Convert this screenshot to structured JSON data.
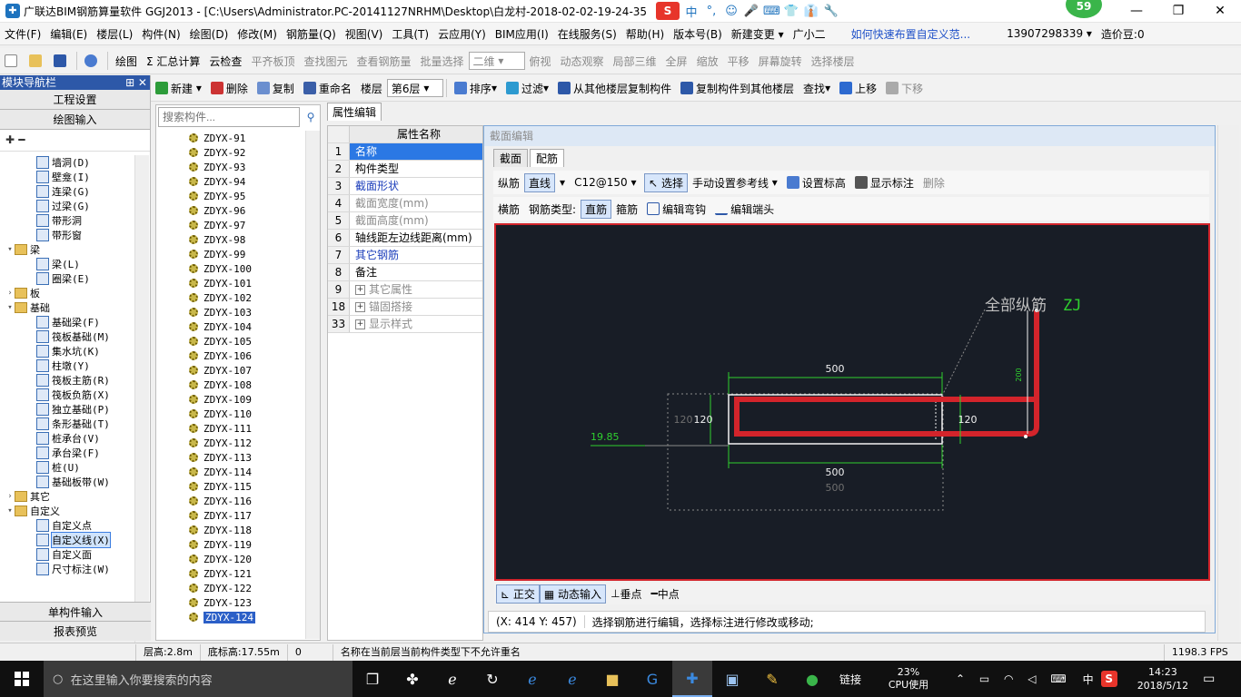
{
  "title_bar": {
    "title": "广联达BIM钢筋算量软件 GGJ2013 - [C:\\Users\\Administrator.PC-20141127NRHM\\Desktop\\白龙村-2018-02-02-19-24-35",
    "ime": [
      "中",
      "°,",
      "☺",
      "🎤",
      "⌨",
      "👕",
      "👔",
      "🔧"
    ],
    "badge": "59",
    "controls": [
      "—",
      "❐",
      "✕"
    ]
  },
  "menu": [
    "文件(F)",
    "编辑(E)",
    "楼层(L)",
    "构件(N)",
    "绘图(D)",
    "修改(M)",
    "钢筋量(Q)",
    "视图(V)",
    "工具(T)",
    "云应用(Y)",
    "BIM应用(I)",
    "在线服务(S)",
    "帮助(H)",
    "版本号(B)",
    "新建变更 ▾",
    "广小二"
  ],
  "menu_link": "如何快速布置自定义范...",
  "account": "13907298339 ▾",
  "beans": "造价豆:0",
  "toolbar1": [
    "绘图",
    "Σ 汇总计算",
    "云检查",
    "平齐板顶",
    "查找图元",
    "查看钢筋量",
    "批量选择",
    "二维",
    "俯视",
    "动态观察",
    "局部三维",
    "全屏",
    "缩放",
    "平移",
    "屏幕旋转",
    "选择楼层"
  ],
  "toolbar2": [
    "新建",
    "删除",
    "复制",
    "重命名",
    "楼层",
    "第6层",
    "排序",
    "过滤",
    "从其他楼层复制构件",
    "复制构件到其他楼层",
    "查找",
    "上移",
    "下移"
  ],
  "nav": {
    "header": "模块导航栏",
    "pin": "⊞ ✕",
    "project_settings": "工程设置",
    "drawing_input": "绘图输入",
    "single_input": "单构件输入",
    "report_preview": "报表预览",
    "tree": [
      {
        "label": "墙洞(D)",
        "level": 2
      },
      {
        "label": "壁龛(I)",
        "level": 2
      },
      {
        "label": "连梁(G)",
        "level": 2
      },
      {
        "label": "过梁(G)",
        "level": 2
      },
      {
        "label": "带形洞",
        "level": 2
      },
      {
        "label": "带形窗",
        "level": 2
      },
      {
        "label": "梁",
        "level": 1,
        "folder": true,
        "exp": "▾"
      },
      {
        "label": "梁(L)",
        "level": 2
      },
      {
        "label": "圈梁(E)",
        "level": 2
      },
      {
        "label": "板",
        "level": 1,
        "folder": true,
        "exp": "›"
      },
      {
        "label": "基础",
        "level": 1,
        "folder": true,
        "exp": "▾"
      },
      {
        "label": "基础梁(F)",
        "level": 2
      },
      {
        "label": "筏板基础(M)",
        "level": 2
      },
      {
        "label": "集水坑(K)",
        "level": 2
      },
      {
        "label": "柱墩(Y)",
        "level": 2
      },
      {
        "label": "筏板主筋(R)",
        "level": 2
      },
      {
        "label": "筏板负筋(X)",
        "level": 2
      },
      {
        "label": "独立基础(P)",
        "level": 2
      },
      {
        "label": "条形基础(T)",
        "level": 2
      },
      {
        "label": "桩承台(V)",
        "level": 2
      },
      {
        "label": "承台梁(F)",
        "level": 2
      },
      {
        "label": "桩(U)",
        "level": 2
      },
      {
        "label": "基础板带(W)",
        "level": 2
      },
      {
        "label": "其它",
        "level": 1,
        "folder": true,
        "exp": "›"
      },
      {
        "label": "自定义",
        "level": 1,
        "folder": true,
        "exp": "▾"
      },
      {
        "label": "自定义点",
        "level": 2
      },
      {
        "label": "自定义线(X)",
        "level": 2,
        "selected": true
      },
      {
        "label": "自定义面",
        "level": 2
      },
      {
        "label": "尺寸标注(W)",
        "level": 2
      }
    ]
  },
  "components": {
    "search_placeholder": "搜索构件...",
    "items": [
      "ZDYX-91",
      "ZDYX-92",
      "ZDYX-93",
      "ZDYX-94",
      "ZDYX-95",
      "ZDYX-96",
      "ZDYX-97",
      "ZDYX-98",
      "ZDYX-99",
      "ZDYX-100",
      "ZDYX-101",
      "ZDYX-102",
      "ZDYX-103",
      "ZDYX-104",
      "ZDYX-105",
      "ZDYX-106",
      "ZDYX-107",
      "ZDYX-108",
      "ZDYX-109",
      "ZDYX-110",
      "ZDYX-111",
      "ZDYX-112",
      "ZDYX-113",
      "ZDYX-114",
      "ZDYX-115",
      "ZDYX-116",
      "ZDYX-117",
      "ZDYX-118",
      "ZDYX-119",
      "ZDYX-120",
      "ZDYX-121",
      "ZDYX-122",
      "ZDYX-123",
      "ZDYX-124"
    ],
    "selected": "ZDYX-124"
  },
  "properties": {
    "tab": "属性编辑",
    "header": "属性名称",
    "rows": [
      {
        "n": "1",
        "label": "名称",
        "style": "sel"
      },
      {
        "n": "2",
        "label": "构件类型",
        "style": ""
      },
      {
        "n": "3",
        "label": "截面形状",
        "style": "blue"
      },
      {
        "n": "4",
        "label": "截面宽度(mm)",
        "style": "gray"
      },
      {
        "n": "5",
        "label": "截面高度(mm)",
        "style": "gray"
      },
      {
        "n": "6",
        "label": "轴线距左边线距离(mm)",
        "style": ""
      },
      {
        "n": "7",
        "label": "其它钢筋",
        "style": "blue"
      },
      {
        "n": "8",
        "label": "备注",
        "style": ""
      },
      {
        "n": "9",
        "label": "其它属性",
        "style": "gray",
        "plus": true
      },
      {
        "n": "18",
        "label": "锚固搭接",
        "style": "gray",
        "plus": true
      },
      {
        "n": "33",
        "label": "显示样式",
        "style": "gray",
        "plus": true
      }
    ]
  },
  "section_editor": {
    "caption": "截面编辑",
    "tabs": [
      "截面",
      "配筋"
    ],
    "row1": {
      "label": "纵筋",
      "line": "直线",
      "spec": "C12@150",
      "select": "选择",
      "manual": "手动设置参考线",
      "set_elev": "设置标高",
      "show_dim": "显示标注",
      "delete": "删除"
    },
    "row2": {
      "label": "横筋",
      "type_label": "钢筋类型:",
      "straight": "直筋",
      "stirrup": "箍筋",
      "edit_hook": "编辑弯钩",
      "edit_end": "编辑端头"
    },
    "drawing": {
      "all_bars": "全部纵筋",
      "zj": "ZJ",
      "dim_top": "500",
      "dim_bottom": "500",
      "dim_bottom_ghost": "500",
      "dim_left": "120",
      "dim_left_ghost": "120",
      "dim_right": "120",
      "dim_vertical": "200",
      "offset": "19.85"
    },
    "bottom": [
      "正交",
      "动态输入",
      "垂点",
      "中点"
    ],
    "coords": "(X: 414 Y: 457)",
    "hint": "选择钢筋进行编辑，选择标注进行修改或移动;"
  },
  "status": {
    "floor_h": "层高:2.8m",
    "bottom_h": "底标高:17.55m",
    "zero": "0",
    "msg": "名称在当前层当前构件类型下不允许重名",
    "fps": "1198.3 FPS"
  },
  "taskbar": {
    "search": "在这里输入你要搜索的内容",
    "link": "链接",
    "cpu_pct": "23%",
    "cpu_label": "CPU使用",
    "lang": "中",
    "time": "14:23",
    "date": "2018/5/12"
  },
  "colors": {
    "nav_header": "#2d58a8",
    "rebar": "#d3242b",
    "canvas_bg": "#181d26",
    "dim_green": "#2fd02f"
  }
}
